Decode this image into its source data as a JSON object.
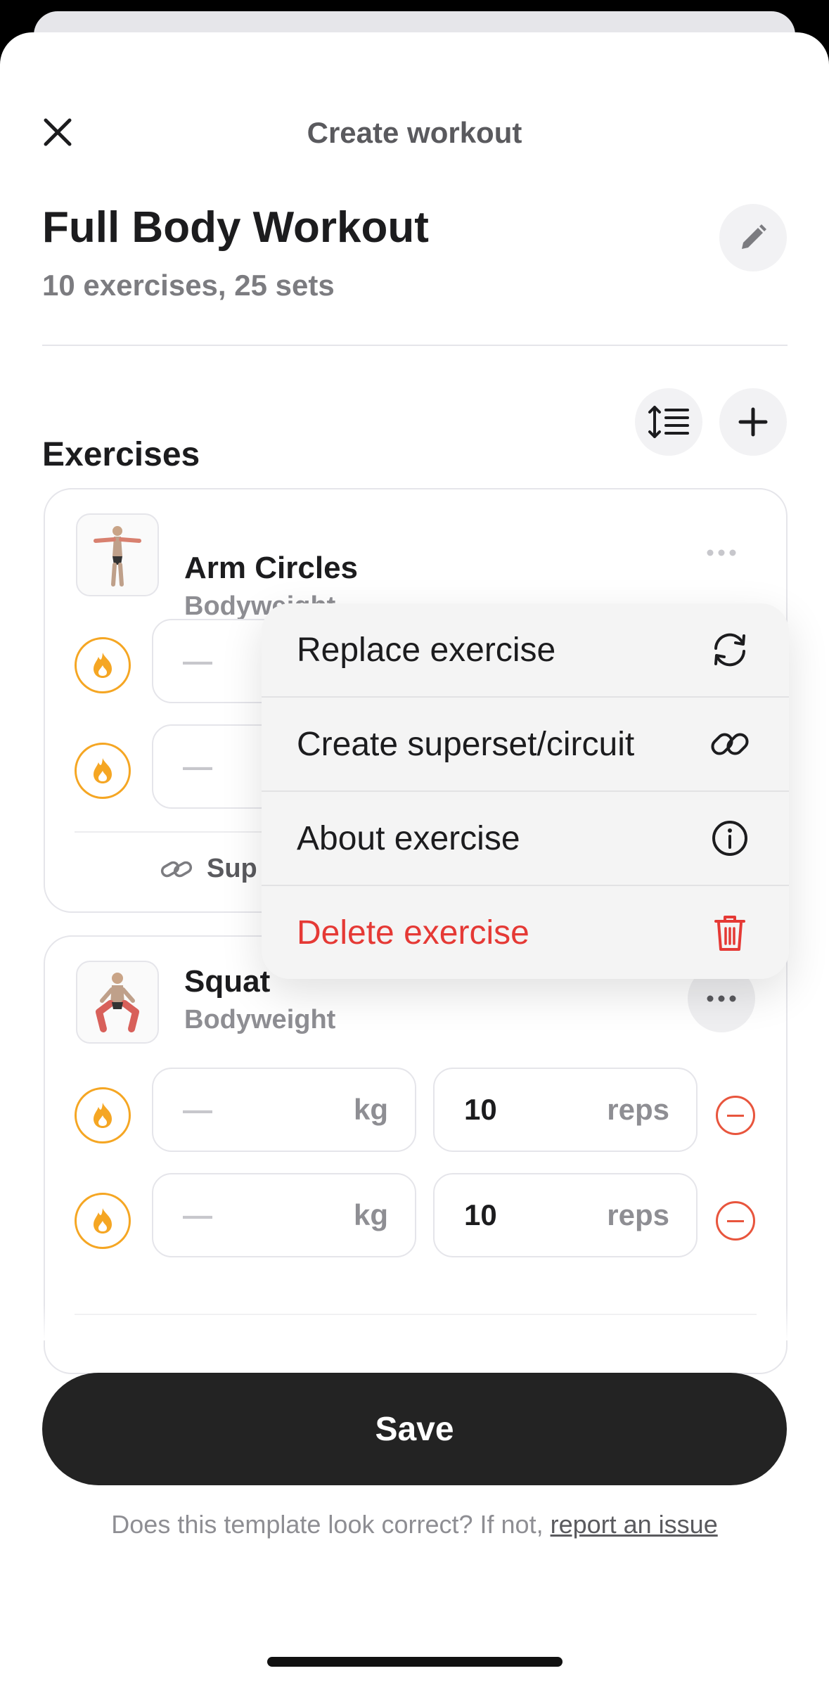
{
  "header": {
    "title": "Create workout"
  },
  "workout": {
    "name": "Full Body Workout",
    "summary": "10 exercises, 25 sets"
  },
  "exercises_section": {
    "title": "Exercises"
  },
  "exercises": [
    {
      "name": "Arm Circles",
      "type": "Bodyweight",
      "sets": [
        {
          "weight_placeholder": "—"
        },
        {
          "weight_placeholder": "—"
        }
      ],
      "footer_link": "Sup"
    },
    {
      "name": "Squat",
      "type": "Bodyweight",
      "sets": [
        {
          "weight_placeholder": "—",
          "weight_unit": "kg",
          "reps": "10",
          "reps_unit": "reps"
        },
        {
          "weight_placeholder": "—",
          "weight_unit": "kg",
          "reps": "10",
          "reps_unit": "reps"
        }
      ]
    }
  ],
  "context_menu": {
    "items": [
      {
        "label": "Replace exercise",
        "icon": "refresh-icon"
      },
      {
        "label": "Create superset/circuit",
        "icon": "link-icon"
      },
      {
        "label": "About exercise",
        "icon": "info-icon"
      },
      {
        "label": "Delete exercise",
        "icon": "trash-icon",
        "destructive": true
      }
    ]
  },
  "save_button": {
    "label": "Save"
  },
  "footer": {
    "text": "Does this template look correct? If not, ",
    "link": "report an issue"
  },
  "colors": {
    "accent": "#f5a623",
    "danger": "#e53935",
    "remove": "#e8553d",
    "primary_button": "#232323"
  }
}
